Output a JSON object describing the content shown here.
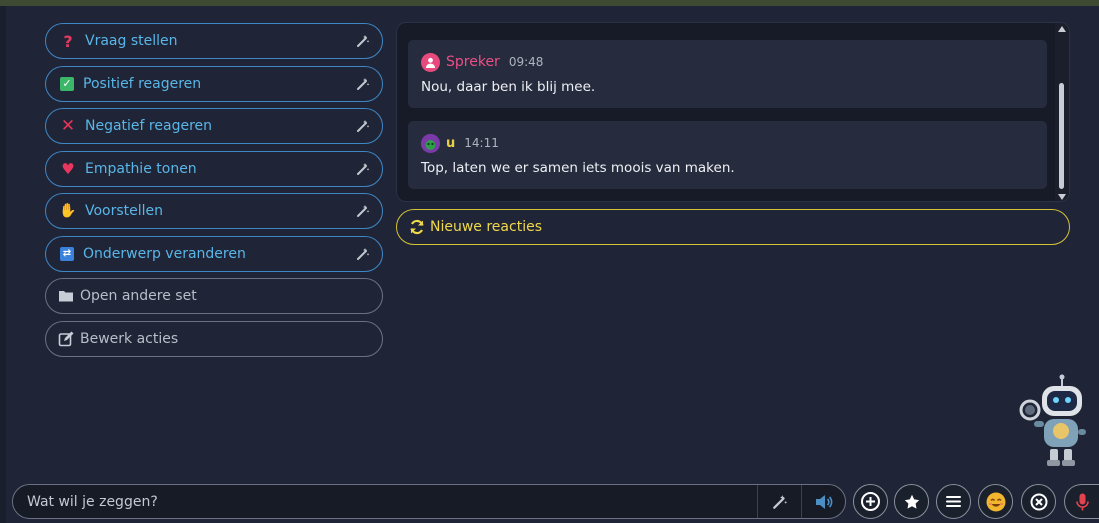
{
  "actions": [
    {
      "label": "Vraag stellen",
      "icon": "question-mark-icon",
      "glyph": "?"
    },
    {
      "label": "Positief reageren",
      "icon": "checkmark-icon",
      "glyph": "✓"
    },
    {
      "label": "Negatief reageren",
      "icon": "cross-icon",
      "glyph": "✕"
    },
    {
      "label": "Empathie tonen",
      "icon": "heart-icon",
      "glyph": "♥"
    },
    {
      "label": "Voorstellen",
      "icon": "waving-hand-icon",
      "glyph": "✋"
    },
    {
      "label": "Onderwerp veranderen",
      "icon": "swap-icon",
      "glyph": "⇄"
    }
  ],
  "extra_actions": {
    "open_set": "Open andere set",
    "edit_actions": "Bewerk acties"
  },
  "messages": [
    {
      "sender": "Spreker",
      "time": "09:48",
      "text": "Nou, daar ben ik blij mee."
    },
    {
      "sender": "u",
      "time": "14:11",
      "text": "Top, laten we er samen iets moois van maken."
    }
  ],
  "new_reactions_label": "Nieuwe reacties",
  "input": {
    "placeholder": "Wat wil je zeggen?",
    "value": ""
  },
  "icons": {
    "wand": "magic-wand-icon",
    "speaker": "speaker-icon",
    "plus": "plus-circle-icon",
    "star": "star-icon",
    "menu": "menu-icon",
    "emoji": "smiley-icon",
    "close": "close-circle-icon",
    "mic": "microphone-icon"
  },
  "colors": {
    "background": "#1f2536",
    "accent_blue": "#59b6e8",
    "accent_yellow": "#f0d84a",
    "speaker_pink": "#ee4d86",
    "mic_red": "#e2434f"
  }
}
